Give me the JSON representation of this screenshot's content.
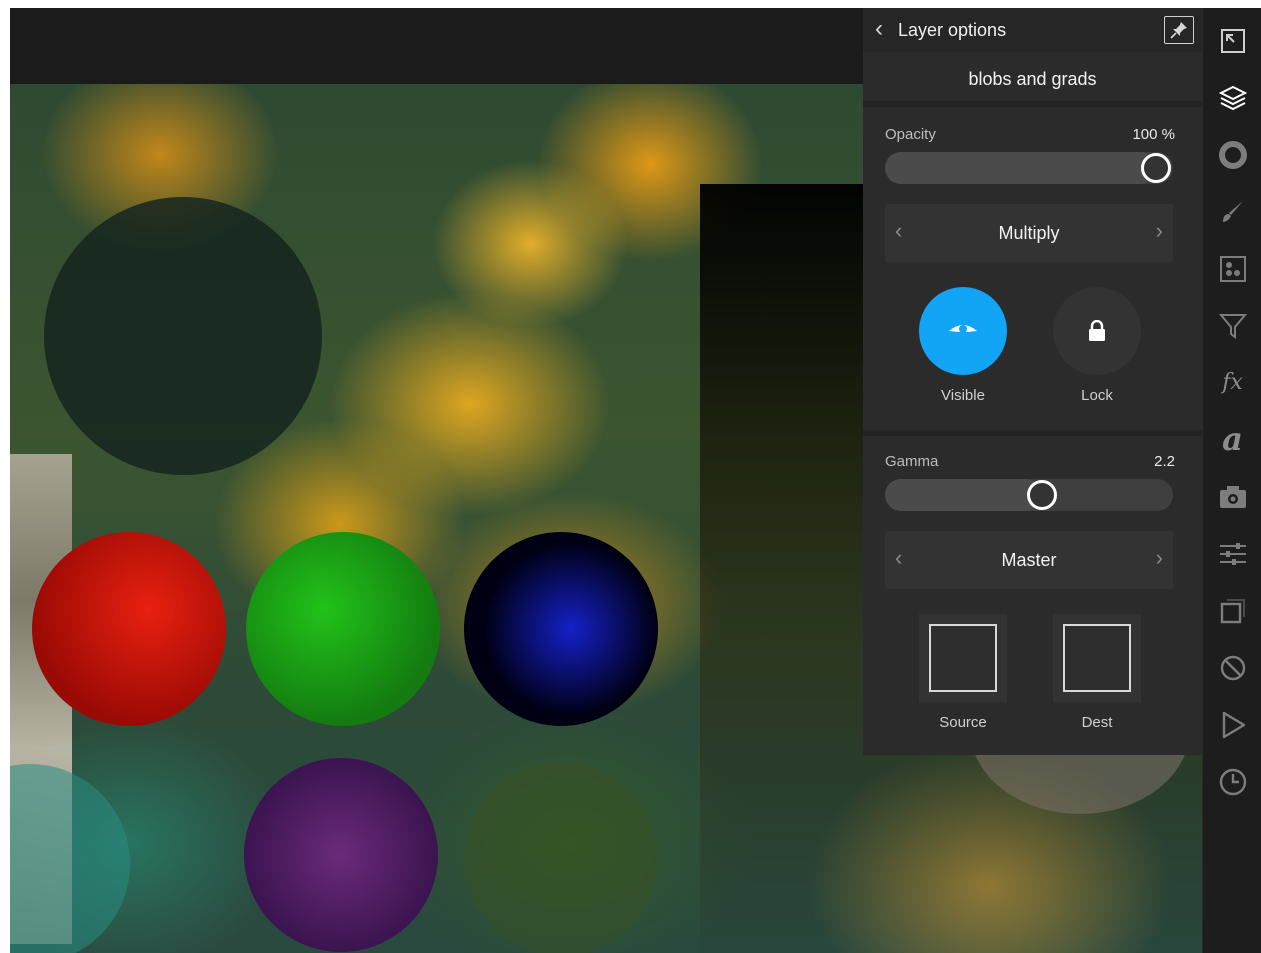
{
  "layer_options_panel": {
    "title": "Layer options",
    "layer_name": "blobs and grads",
    "opacity": {
      "label": "Opacity",
      "value_text": "100 %",
      "value": 100
    },
    "blend_mode": "Multiply",
    "visible_label": "Visible",
    "lock_label": "Lock",
    "gamma": {
      "label": "Gamma",
      "value_text": "2.2",
      "fraction": 0.55
    },
    "channel": "Master",
    "source_label": "Source",
    "dest_label": "Dest"
  },
  "toolbar": {
    "tools": [
      "fullscreen-icon",
      "layers-icon",
      "color-wheel-icon",
      "brush-icon",
      "dots-pattern-icon",
      "filter-funnel-icon",
      "fx-icon",
      "text-icon",
      "camera-icon",
      "sliders-icon",
      "crop-square-icon",
      "disabled-circle-icon",
      "play-icon",
      "history-clock-icon"
    ],
    "fx_text": "fx",
    "text_tool_text": "a"
  },
  "colors": {
    "accent_blue": "#12a4f5",
    "panel_bg": "#2b2b2b",
    "toolbar_bg": "#1d1d1d"
  }
}
